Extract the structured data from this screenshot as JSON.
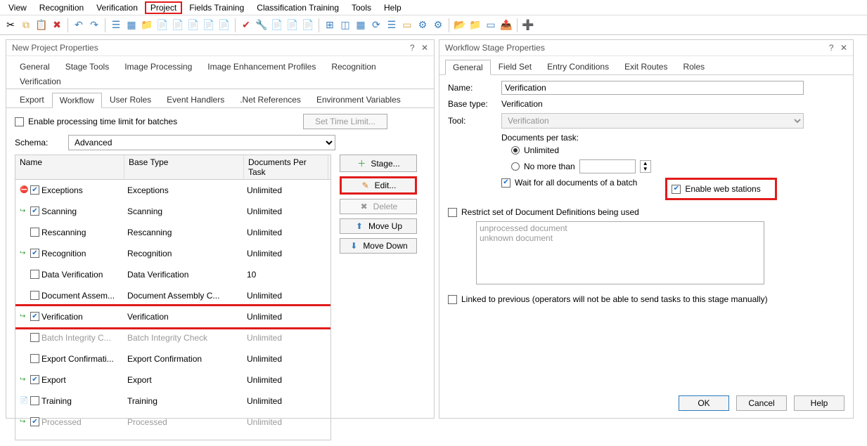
{
  "menubar": [
    "View",
    "Recognition",
    "Verification",
    "Project",
    "Fields Training",
    "Classification Training",
    "Tools",
    "Help"
  ],
  "menubar_highlight_index": 3,
  "dialog_left": {
    "title": "New Project Properties",
    "tabs_row1": [
      "General",
      "Stage Tools",
      "Image Processing",
      "Image Enhancement Profiles",
      "Recognition",
      "Verification"
    ],
    "tabs_row2": [
      "Export",
      "Workflow",
      "User Roles",
      "Event Handlers",
      ".Net References",
      "Environment Variables"
    ],
    "active_tab": "Workflow",
    "enable_time_limit_label": "Enable processing time limit for batches",
    "set_time_limit_btn": "Set Time Limit...",
    "schema_label": "Schema:",
    "schema_value": "Advanced",
    "table_headers": {
      "name": "Name",
      "base": "Base Type",
      "docs": "Documents Per Task"
    },
    "stages": [
      {
        "name": "Exceptions",
        "base": "Exceptions",
        "docs": "Unlimited",
        "checked": true,
        "icon": "⛔"
      },
      {
        "name": "Scanning",
        "base": "Scanning",
        "docs": "Unlimited",
        "checked": true,
        "icon": "↪"
      },
      {
        "name": "Rescanning",
        "base": "Rescanning",
        "docs": "Unlimited",
        "checked": false,
        "icon": ""
      },
      {
        "name": "Recognition",
        "base": "Recognition",
        "docs": "Unlimited",
        "checked": true,
        "icon": "↪"
      },
      {
        "name": "Data Verification",
        "base": "Data Verification",
        "docs": "10",
        "checked": false,
        "icon": ""
      },
      {
        "name": "Document Assem...",
        "base": "Document Assembly C...",
        "docs": "Unlimited",
        "checked": false,
        "icon": ""
      },
      {
        "name": "Verification",
        "base": "Verification",
        "docs": "Unlimited",
        "checked": true,
        "icon": "↪",
        "highlight": true
      },
      {
        "name": "Batch Integrity C...",
        "base": "Batch Integrity Check",
        "docs": "Unlimited",
        "checked": false,
        "icon": "",
        "disabled": true
      },
      {
        "name": "Export Confirmati...",
        "base": "Export Confirmation",
        "docs": "Unlimited",
        "checked": false,
        "icon": ""
      },
      {
        "name": "Export",
        "base": "Export",
        "docs": "Unlimited",
        "checked": true,
        "icon": "↪"
      },
      {
        "name": "Training",
        "base": "Training",
        "docs": "Unlimited",
        "checked": false,
        "icon": "📄"
      },
      {
        "name": "Processed",
        "base": "Processed",
        "docs": "Unlimited",
        "checked": true,
        "icon": "↪",
        "disabled": true
      }
    ],
    "side_buttons": {
      "stage": "Stage...",
      "edit": "Edit...",
      "delete": "Delete",
      "moveup": "Move Up",
      "movedown": "Move Down"
    }
  },
  "dialog_right": {
    "title": "Workflow Stage Properties",
    "tabs": [
      "General",
      "Field Set",
      "Entry Conditions",
      "Exit Routes",
      "Roles"
    ],
    "active_tab": "General",
    "name_label": "Name:",
    "name_value": "Verification",
    "basetype_label": "Base type:",
    "basetype_value": "Verification",
    "tool_label": "Tool:",
    "tool_value": "Verification",
    "docs_per_task_label": "Documents per task:",
    "unlimited_label": "Unlimited",
    "nomore_label": "No more than",
    "nomore_value": "",
    "wait_label": "Wait for all documents of a batch",
    "enable_web_label": "Enable web stations",
    "restrict_label": "Restrict set of Document Definitions being used",
    "list_items": [
      "unprocessed document",
      "unknown document"
    ],
    "linked_label": "Linked to previous (operators will not be able to send tasks to this stage manually)",
    "buttons": {
      "ok": "OK",
      "cancel": "Cancel",
      "help": "Help"
    }
  }
}
